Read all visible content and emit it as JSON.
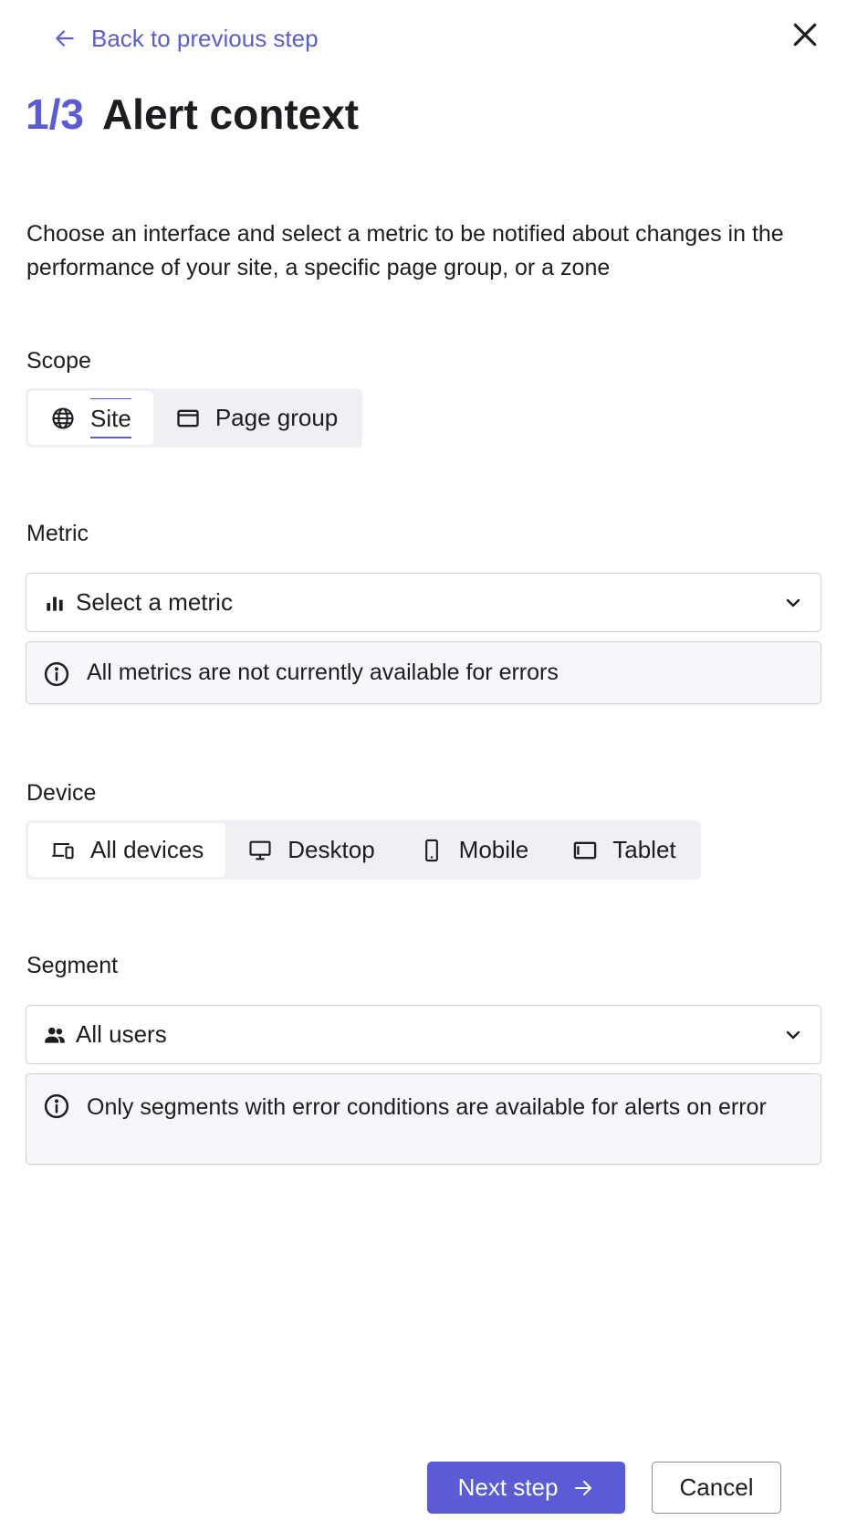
{
  "nav": {
    "back_label": "Back to previous step",
    "close_icon": "close-icon"
  },
  "header": {
    "step": "1/3",
    "title": "Alert context"
  },
  "description": "Choose an interface and select a metric to be notified about changes in the performance of your site, a specific page group, or a zone",
  "scope": {
    "label": "Scope",
    "options": [
      {
        "label": "Site",
        "icon": "globe-icon",
        "selected": true
      },
      {
        "label": "Page group",
        "icon": "window-icon",
        "selected": false
      }
    ]
  },
  "metric": {
    "label": "Metric",
    "value": "Select a metric",
    "icon": "bar-chart-icon",
    "info": "All metrics are not currently available for errors"
  },
  "device": {
    "label": "Device",
    "options": [
      {
        "label": "All devices",
        "icon": "devices-icon",
        "selected": true
      },
      {
        "label": "Desktop",
        "icon": "desktop-icon",
        "selected": false
      },
      {
        "label": "Mobile",
        "icon": "mobile-icon",
        "selected": false
      },
      {
        "label": "Tablet",
        "icon": "tablet-icon",
        "selected": false
      }
    ]
  },
  "segment": {
    "label": "Segment",
    "value": "All users",
    "icon": "users-icon",
    "info": "Only segments with error conditions are available for alerts on error"
  },
  "footer": {
    "next_label": "Next step",
    "cancel_label": "Cancel"
  },
  "colors": {
    "accent": "#5b5bd6",
    "text": "#1c1c21",
    "border": "#cdced6",
    "segmented_bg": "#eff0f4",
    "info_bg": "#f6f7fb"
  }
}
